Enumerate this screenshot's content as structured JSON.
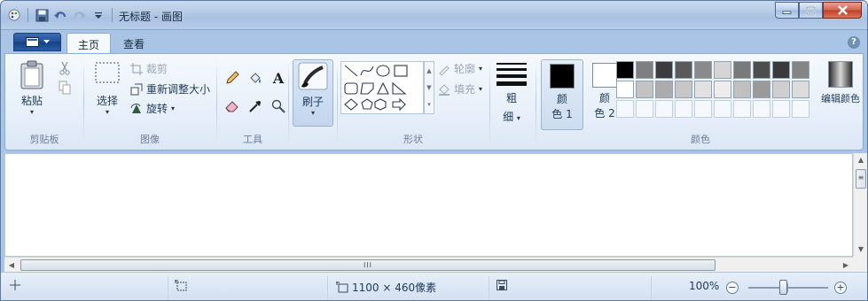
{
  "window": {
    "title": "无标题 - 画图",
    "qat_icons": [
      "paint-app-icon",
      "save-icon",
      "undo-icon",
      "redo-icon",
      "customize-qat-icon"
    ]
  },
  "tabs": [
    {
      "label": "主页",
      "active": true
    },
    {
      "label": "查看",
      "active": false
    }
  ],
  "ribbon": {
    "clipboard": {
      "paste_label": "粘贴",
      "cut_icon": "scissors-icon",
      "copy_icon": "copy-icon",
      "group_label": "剪贴板"
    },
    "image": {
      "select_label": "选择",
      "crop_label": "裁剪",
      "resize_label": "重新调整大小",
      "rotate_label": "旋转",
      "group_label": "图像"
    },
    "tools": {
      "items": [
        "pencil-icon",
        "fill-bucket-icon",
        "text-icon",
        "eraser-icon",
        "color-picker-icon",
        "magnifier-icon"
      ],
      "text_glyph": "A",
      "group_label": "工具"
    },
    "brushes": {
      "label": "刷子"
    },
    "shapes": {
      "outline_label": "轮廓",
      "fill_label": "填充",
      "group_label": "形状"
    },
    "size": {
      "label_line1": "粗",
      "label_line2": "细"
    },
    "colors": {
      "color1_line1": "颜",
      "color1_line2": "色 1",
      "color2_line1": "颜",
      "color2_line2": "色 2",
      "edit_label": "编辑颜色",
      "group_label": "颜色",
      "color1_value": "#000000",
      "color2_value": "#ffffff",
      "palette_row1": [
        "#000000",
        "#7f7f7f",
        "#323232",
        "#4a4a4a",
        "#666666",
        "#a0a0a0",
        "#d7d7d7",
        "#808080",
        "#5d5d5d",
        "#3c3c3c",
        "#8c8c8c"
      ],
      "palette_row2": [
        "#ffffff",
        "#c3c3c3",
        "#b0b0b0",
        "#9c9c9c",
        "#c8c8c8",
        "#e6e6e6",
        "#bfbfbf",
        "#999999",
        "#cfcfcf",
        "#b3b3b3"
      ]
    }
  },
  "statusbar": {
    "dimensions": "1100 × 460像素",
    "zoom": "100%",
    "zoom_out": "−",
    "zoom_in": "+"
  },
  "scroll": {
    "hthumb_grip": "III"
  }
}
